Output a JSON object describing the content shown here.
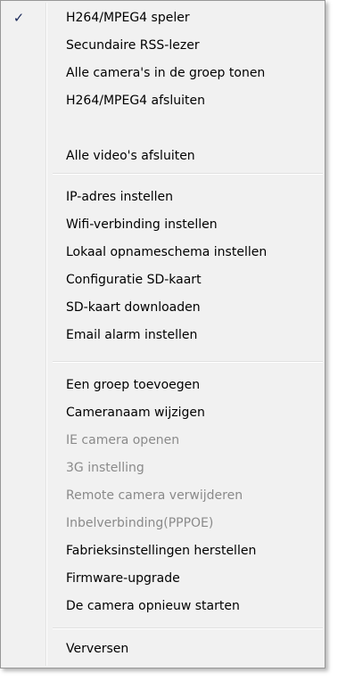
{
  "menu": {
    "items": [
      {
        "label": "H264/MPEG4 speler",
        "checked": true,
        "disabled": false
      },
      {
        "label": "Secundaire RSS-lezer",
        "checked": false,
        "disabled": false
      },
      {
        "label": "Alle camera's in de groep tonen",
        "checked": false,
        "disabled": false
      },
      {
        "label": "H264/MPEG4 afsluiten",
        "checked": false,
        "disabled": false
      },
      {
        "label": "Alle video's afsluiten",
        "checked": false,
        "disabled": false
      },
      {
        "label": "IP-adres instellen",
        "checked": false,
        "disabled": false
      },
      {
        "label": "Wifi-verbinding instellen",
        "checked": false,
        "disabled": false
      },
      {
        "label": "Lokaal opnameschema instellen",
        "checked": false,
        "disabled": false
      },
      {
        "label": "Configuratie SD-kaart",
        "checked": false,
        "disabled": false
      },
      {
        "label": "SD-kaart downloaden",
        "checked": false,
        "disabled": false
      },
      {
        "label": "Email alarm instellen",
        "checked": false,
        "disabled": false
      },
      {
        "label": "Een groep toevoegen",
        "checked": false,
        "disabled": false
      },
      {
        "label": "Cameranaam wijzigen",
        "checked": false,
        "disabled": false
      },
      {
        "label": "IE camera openen",
        "checked": false,
        "disabled": true
      },
      {
        "label": "3G instelling",
        "checked": false,
        "disabled": true
      },
      {
        "label": "Remote camera verwijderen",
        "checked": false,
        "disabled": true
      },
      {
        "label": "Inbelverbinding(PPPOE)",
        "checked": false,
        "disabled": true
      },
      {
        "label": "Fabrieksinstellingen herstellen",
        "checked": false,
        "disabled": false
      },
      {
        "label": "Firmware-upgrade",
        "checked": false,
        "disabled": false
      },
      {
        "label": "De camera opnieuw starten",
        "checked": false,
        "disabled": false
      },
      {
        "label": "Verversen",
        "checked": false,
        "disabled": false
      }
    ],
    "check_glyph": "✓"
  },
  "colors": {
    "menu_bg": "#f1f1f1",
    "disabled_text": "#8a8a8a",
    "check": "#1b2a5a"
  }
}
